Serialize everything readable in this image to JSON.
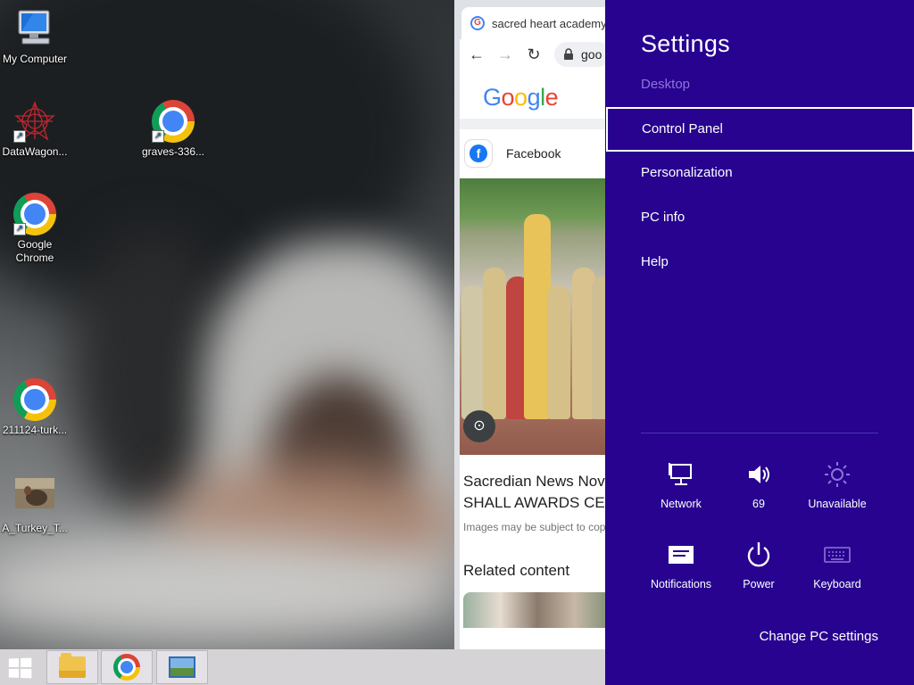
{
  "desktop": {
    "icons": [
      {
        "label": "My Computer",
        "icon": "computer-icon"
      },
      {
        "label": "DataWagon...",
        "icon": "datawagon-icon"
      },
      {
        "label": "graves-336...",
        "icon": "chrome-icon"
      },
      {
        "label": "Google Chrome",
        "icon": "chrome-icon"
      },
      {
        "label": "211124-turk...",
        "icon": "chrome-icon"
      },
      {
        "label": "A_Turkey_T...",
        "icon": "turkey-image-icon"
      }
    ]
  },
  "browser": {
    "tab_title": "sacred heart academy",
    "address": "goo",
    "google_logo": [
      "G",
      "o",
      "o",
      "g",
      "l",
      "e"
    ],
    "source_site": "Facebook",
    "result_title_line1": "Sacredian News Nov",
    "result_title_line2": "SHALL AWARDS CER",
    "result_note": "Images may be subject to cop",
    "related_heading": "Related content"
  },
  "taskbar": {
    "apps": [
      "file-explorer-icon",
      "chrome-icon",
      "photos-icon"
    ]
  },
  "settings": {
    "title": "Settings",
    "context": "Desktop",
    "items": [
      "Control Panel",
      "Personalization",
      "PC info",
      "Help"
    ],
    "selected_item": "Control Panel",
    "tiles": [
      {
        "label": "Network",
        "icon": "network-icon"
      },
      {
        "label": "69",
        "icon": "volume-icon"
      },
      {
        "label": "Unavailable",
        "icon": "brightness-icon"
      },
      {
        "label": "Notifications",
        "icon": "notifications-icon"
      },
      {
        "label": "Power",
        "icon": "power-icon"
      },
      {
        "label": "Keyboard",
        "icon": "keyboard-icon"
      }
    ],
    "change_pc_settings": "Change PC settings",
    "accent_color": "#270390"
  }
}
